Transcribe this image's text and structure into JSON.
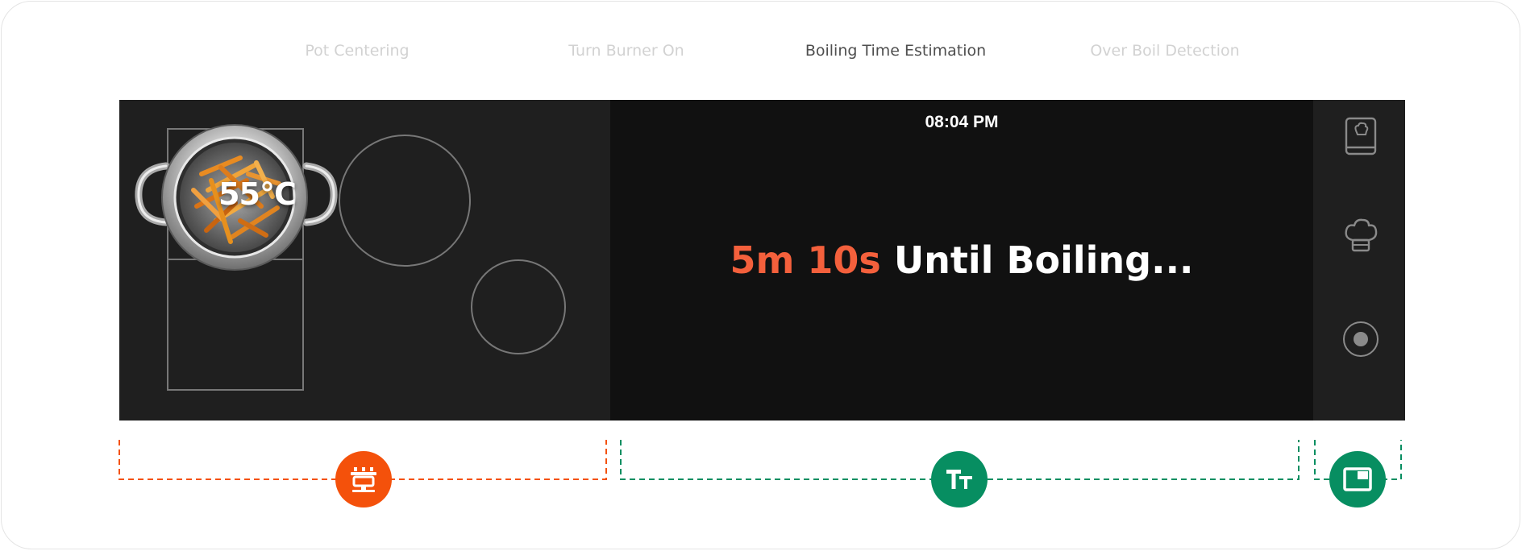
{
  "tabs": [
    {
      "label": "Pot Centering",
      "active": false
    },
    {
      "label": "Turn Burner On",
      "active": false
    },
    {
      "label": "Boiling Time Estimation",
      "active": true
    },
    {
      "label": "Over Boil Detection",
      "active": false
    }
  ],
  "cooktop": {
    "pot_temperature": "55°C"
  },
  "display": {
    "time": "08:04 PM",
    "countdown": "5m 10s",
    "status_suffix": " Until Boiling..."
  },
  "side_rail": {
    "icons": [
      "recipe-book-icon",
      "chef-hat-icon",
      "record-icon"
    ]
  },
  "annotations": {
    "icons": [
      "stove-icon",
      "text-size-icon",
      "picture-in-picture-icon"
    ],
    "colors": {
      "orange": "#f4510b",
      "green": "#078e61"
    }
  },
  "colors": {
    "accent": "#f4603c",
    "cooktop_bg": "#1f1f1f",
    "display_bg": "#111111"
  }
}
